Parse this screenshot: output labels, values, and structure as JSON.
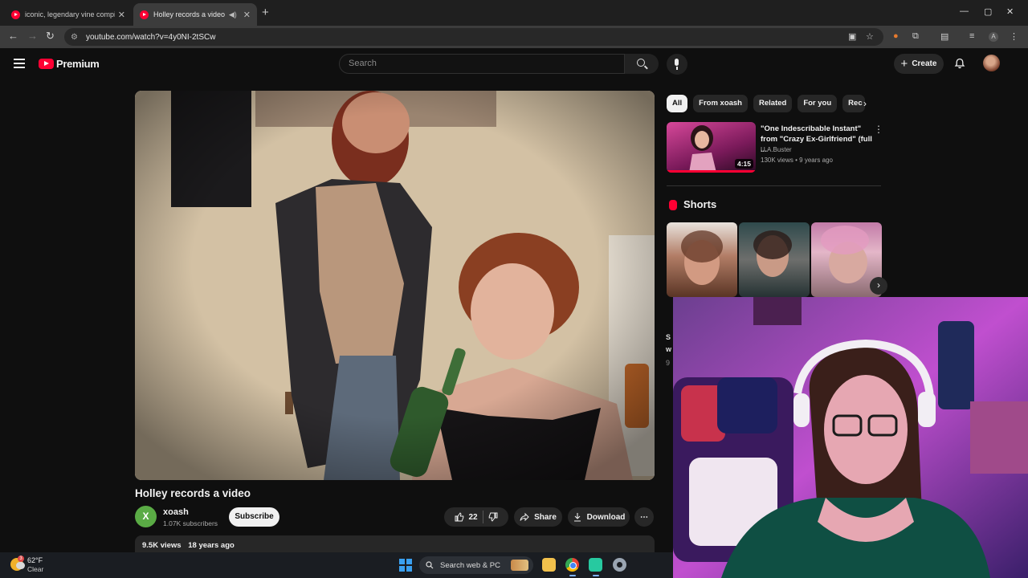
{
  "browser": {
    "tabs": [
      {
        "title": "iconic, legendary vine compilat"
      },
      {
        "title": "Holley records a video - Yo"
      }
    ],
    "url": "youtube.com/watch?v=4y0NI-2tSCw"
  },
  "youtube": {
    "logo_text": "Premium",
    "search_placeholder": "Search",
    "create_label": "Create"
  },
  "video": {
    "title": "Holley records a video",
    "channel": {
      "initial": "X",
      "name": "xoash",
      "subscribers": "1.07K subscribers"
    },
    "subscribe_label": "Subscribe",
    "likes": "22",
    "share_label": "Share",
    "download_label": "Download",
    "views": "9.5K views",
    "age": "18 years ago"
  },
  "sidebar": {
    "chips": [
      "All",
      "From xoash",
      "Related",
      "For you",
      "Rec"
    ],
    "recommendation": {
      "title": "\"One Indescribable Instant\" from \"Crazy Ex-Girlfriend\" (full ...",
      "channel": "U.A.Buster",
      "meta": "130K views • 9 years ago",
      "duration": "4:15",
      "watched_fraction": 1.0
    },
    "shorts_label": "Shorts",
    "peek_texts": [
      "S",
      "w",
      "9"
    ]
  },
  "taskbar": {
    "weather_badge": "3",
    "temperature": "62°F",
    "condition": "Clear",
    "search_label": "Search web & PC"
  },
  "icons": [
    "menu-icon",
    "search-icon",
    "mic-icon",
    "bell-icon",
    "like-icon",
    "dislike-icon",
    "share-icon",
    "download-icon",
    "more-icon",
    "chevron-right-icon",
    "shorts-icon"
  ]
}
